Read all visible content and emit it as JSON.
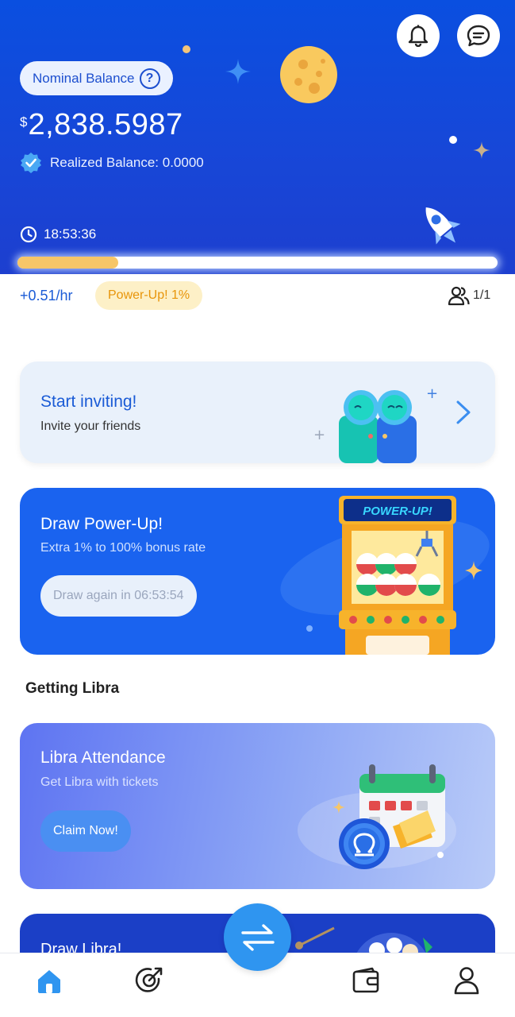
{
  "header": {
    "nominal_balance_label": "Nominal Balance",
    "help_glyph": "?",
    "currency_symbol": "$",
    "balance_amount": "2,838.5987",
    "realized_balance": "Realized Balance: 0.0000",
    "timer": "18:53:36",
    "progress_fraction": 0.21,
    "icons": [
      "bell-icon",
      "chat-icon",
      "help-icon",
      "verified-badge-icon",
      "clock-icon",
      "rocket-icon",
      "moon-icon",
      "star-icon"
    ]
  },
  "stats": {
    "rate": "+0.51/hr",
    "powerup_badge": "Power-Up! 1%",
    "team_count": "1/1"
  },
  "invite_card": {
    "title": "Start inviting!",
    "subtitle": "Invite your friends"
  },
  "draw_powerup_card": {
    "title": "Draw Power-Up!",
    "subtitle": "Extra 1% to 100% bonus rate",
    "button": "Draw again in 06:53:54",
    "machine_sign": "POWER-UP!"
  },
  "section": {
    "getting_libra": "Getting Libra"
  },
  "attendance_card": {
    "title": "Libra Attendance",
    "subtitle": "Get Libra with tickets",
    "button": "Claim Now!"
  },
  "draw_libra_card": {
    "title": "Draw Libra!"
  },
  "bottom_nav": {
    "items": [
      "home-icon",
      "mining-icon",
      "swap-icon",
      "wallet-icon",
      "profile-icon"
    ],
    "active": "home-icon"
  },
  "colors": {
    "primary_blue": "#1a63ef",
    "hero_blue": "#0a4fe0",
    "accent_yellow": "#f7c668",
    "powerup_text": "#e8950a",
    "link_blue": "#1a5bd6"
  }
}
